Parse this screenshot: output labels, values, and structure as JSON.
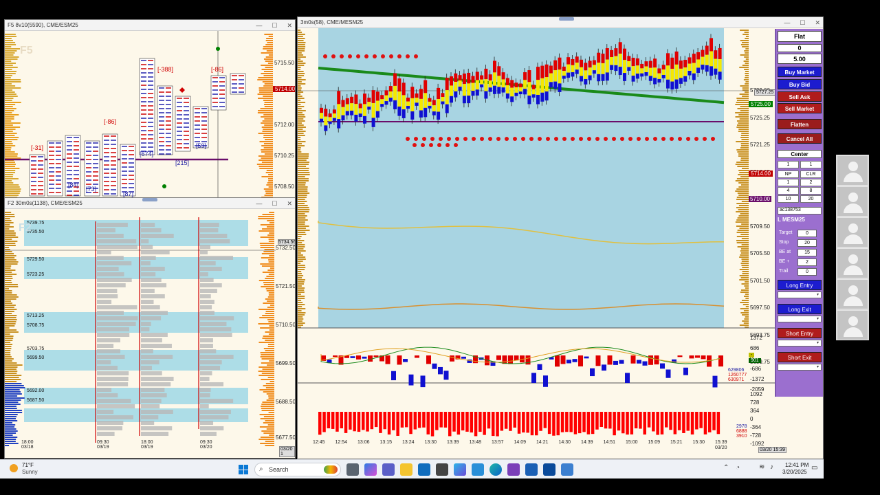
{
  "win_f5": {
    "title": "F5 8v10(5590), CME/ESM25",
    "watermark": "F5",
    "prices": [
      "5715.50",
      "5712.00",
      "5710.25",
      "5708.50"
    ],
    "last_price": "5714.00",
    "delta_labels": [
      "[-31]",
      "[-388]",
      "[-86]",
      "[-86]"
    ],
    "blue_labels": [
      "[84]",
      "[73]",
      "[87]",
      "[674]",
      "[215]",
      "[59]"
    ],
    "time_labels": []
  },
  "win_f2": {
    "title": "F2 30m0s(1138), CME/ESM25",
    "watermark": "F2",
    "level_labels": [
      "5739.75",
      "5735.50",
      "5729.50",
      "5723.25",
      "5713.25",
      "5708.75",
      "5703.75",
      "5699.50",
      "5692.00",
      "5687.50"
    ],
    "prices": [
      "5732.50",
      "5721.50",
      "5710.50",
      "5699.50",
      "5688.50",
      "5677.50"
    ],
    "right_tag": "5734.56",
    "time_labels": [
      {
        "t": "18:00",
        "d": "03/18"
      },
      {
        "t": "09:30",
        "d": "03/19"
      },
      {
        "t": "18:00",
        "d": "03/19"
      },
      {
        "t": "09:30",
        "d": "03/20"
      }
    ],
    "corner_tag": "03/20 1"
  },
  "win_main": {
    "title": "3m0s(58), CME/MESM25",
    "prices": [
      "5729.00",
      "5725.25",
      "5721.25",
      "5717.25",
      "5713.25",
      "5709.50",
      "5705.50",
      "5701.50",
      "5697.50",
      "5693.75",
      "5689.75"
    ],
    "tag_upper": "5727.25",
    "tag_green": "5725.00",
    "tag_last": "5714.00",
    "tag_mid": "5710.00",
    "osc_scale": [
      "1372",
      "686",
      "0",
      "-686",
      "-1372",
      "-2059"
    ],
    "osc_tags": [
      "629806",
      "1260777",
      "630971"
    ],
    "osc_box_tags": [
      "-",
      "901"
    ],
    "vol_scale": [
      "1092",
      "728",
      "364",
      "0",
      "-364",
      "-728",
      "-1092"
    ],
    "vol_tags": [
      "2978",
      "6888",
      "3910"
    ],
    "time_axis": [
      "12:45",
      "12:54",
      "13:06",
      "13:15",
      "13:24",
      "13:30",
      "13:39",
      "13:48",
      "13:57",
      "14:09",
      "14:21",
      "14:30",
      "14:39",
      "14:51",
      "15:00",
      "15:09",
      "15:21",
      "15:30",
      "15:39"
    ],
    "time_date": "03/20",
    "corner_tag": "03/20 15:39"
  },
  "side_panel": {
    "position_label": "Flat",
    "qty_value": "0",
    "price_value": "5.00",
    "buttons": {
      "buy_market": "Buy Market",
      "buy_bid": "Buy Bid",
      "sell_ask": "Sell Ask",
      "sell_market": "Sell Market",
      "flatten": "Flatten",
      "cancel_all": "Cancel All",
      "center": "Center"
    },
    "qty_selectors": [
      "1",
      "1"
    ],
    "grid": [
      "NP",
      "CLR",
      "1",
      "2",
      "4",
      "8",
      "10",
      "20"
    ],
    "account": "ac138753",
    "instrument": "L MESM25",
    "fields": [
      {
        "label": "Target",
        "value": "0"
      },
      {
        "label": "Stop",
        "value": "20"
      },
      {
        "label": "BE at",
        "value": "15"
      },
      {
        "label": "BE +",
        "value": "2"
      },
      {
        "label": "Trail",
        "value": "0"
      }
    ],
    "entry_buttons": [
      "Long Entry",
      "Long Exit",
      "Short Entry",
      "Short Exit"
    ],
    "colors": {
      "buy": "#1c1ccf",
      "sell": "#b01c1c",
      "panel": "#9b6fcf"
    }
  },
  "taskbar": {
    "weather_temp": "71°F",
    "weather_desc": "Sunny",
    "search_placeholder": "Search",
    "time": "12:41 PM",
    "date": "3/20/2025"
  }
}
